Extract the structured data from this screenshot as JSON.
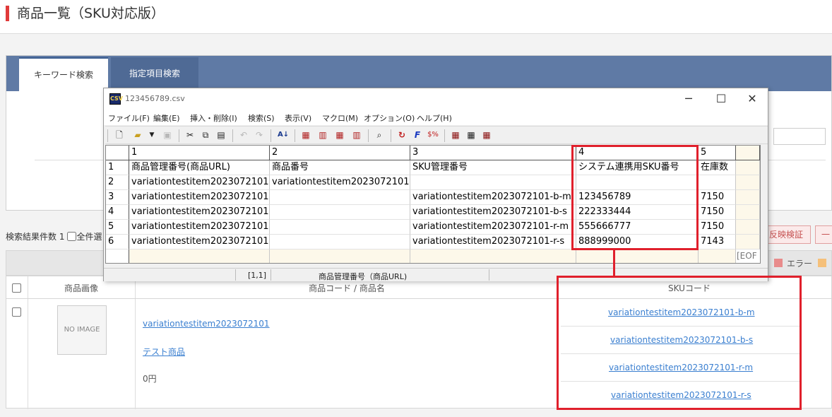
{
  "page": {
    "title": "商品一覧（SKU対応版）"
  },
  "search": {
    "tabs": [
      "キーワード検索",
      "指定項目検索"
    ]
  },
  "results": {
    "count_label": "検索結果件数 1",
    "select_all_label": "全件選",
    "reflect_button": "反映検証",
    "extra_button": "一"
  },
  "legend": {
    "error_label": "エラー",
    "error_color": "#e88b8b",
    "warn_color": "#f5c07a"
  },
  "table": {
    "headers": [
      "商品画像",
      "商品コード / 商品名",
      "SKUコード"
    ],
    "row": {
      "no_image": "NO IMAGE",
      "item_code": "variationtestitem2023072101",
      "item_name": "テスト商品",
      "price": "0円",
      "sku_codes": [
        "variationtestitem2023072101-b-m",
        "variationtestitem2023072101-b-s",
        "variationtestitem2023072101-r-m",
        "variationtestitem2023072101-r-s"
      ]
    }
  },
  "csv_window": {
    "title": "123456789.csv",
    "icon_text": "CSV",
    "controls": [
      "─",
      "☐",
      "✕"
    ],
    "menu": [
      "ファイル(F)",
      "編集(E)",
      "挿入・削除(I)",
      "検索(S)",
      "表示(V)",
      "マクロ(M)",
      "オプション(O)",
      "ヘルプ(H)"
    ],
    "column_numbers": [
      "1",
      "2",
      "3",
      "4",
      "5"
    ],
    "row_numbers": [
      "1",
      "2",
      "3",
      "4",
      "5",
      "6"
    ],
    "rows": [
      [
        "商品管理番号(商品URL)",
        "商品番号",
        "SKU管理番号",
        "システム連携用SKU番号",
        "在庫数"
      ],
      [
        "variationtestitem2023072101",
        "variationtestitem2023072101",
        "",
        "",
        ""
      ],
      [
        "variationtestitem2023072101",
        "",
        "variationtestitem2023072101-b-m",
        "123456789",
        "7150"
      ],
      [
        "variationtestitem2023072101",
        "",
        "variationtestitem2023072101-b-s",
        "222333444",
        "7150"
      ],
      [
        "variationtestitem2023072101",
        "",
        "variationtestitem2023072101-r-m",
        "555666777",
        "7150"
      ],
      [
        "variationtestitem2023072101",
        "",
        "variationtestitem2023072101-r-s",
        "888999000",
        "7143"
      ]
    ],
    "eof_label": "[EOF",
    "status": {
      "position": "[1,1]",
      "field": "商品管理番号（商品URL)"
    },
    "toolbar_icons": [
      "new-file-icon",
      "open-folder-icon",
      "dropdown-icon",
      "save-icon",
      "cut-icon",
      "copy-icon",
      "paste-icon",
      "undo-icon",
      "redo-icon",
      "sort-icon",
      "insert-row-icon",
      "insert-col-icon",
      "delete-row-icon",
      "delete-col-icon",
      "find-icon",
      "refresh-icon",
      "function-icon",
      "formula-icon",
      "grid-icon",
      "table-icon",
      "table-alt-icon"
    ],
    "highlight_color": "#e0202c"
  }
}
